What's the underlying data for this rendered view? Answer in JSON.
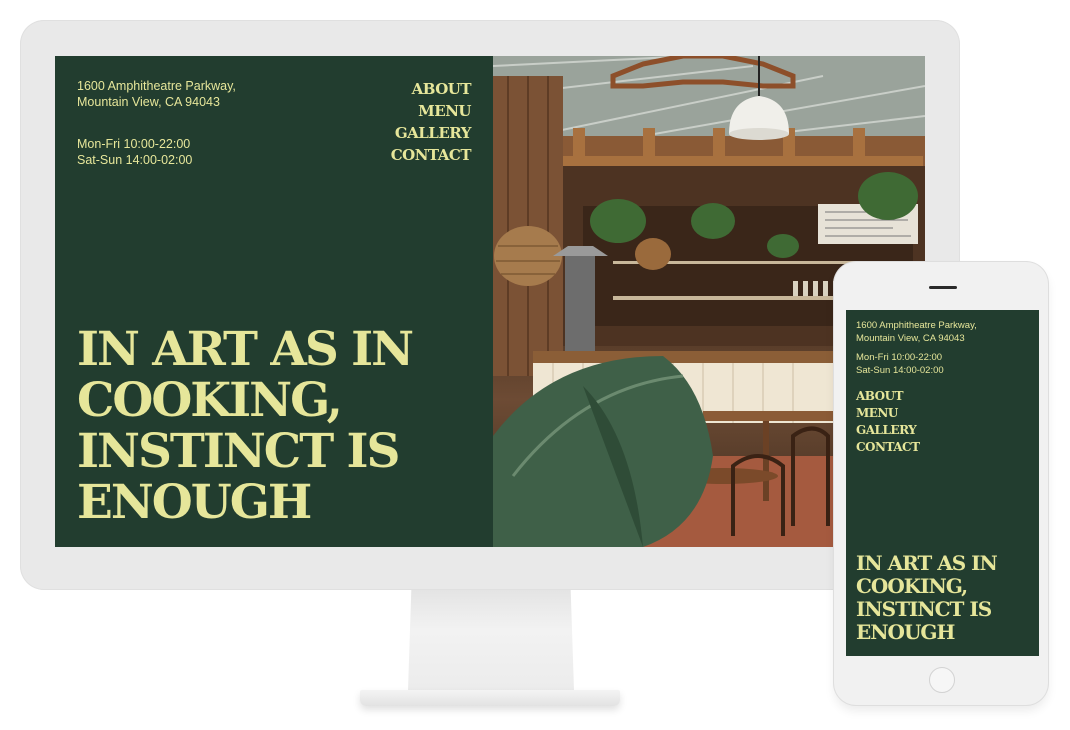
{
  "site": {
    "address": [
      "1600 Amphitheatre Parkway,",
      "Mountain View, CA 94043"
    ],
    "hours": [
      "Mon-Fri 10:00-22:00",
      "Sat-Sun 14:00-02:00"
    ],
    "nav": [
      "ABOUT",
      "MENU",
      "GALLERY",
      "CONTACT"
    ],
    "headline": [
      "IN ART AS IN",
      "COOKING,",
      "INSTINCT IS",
      "ENOUGH"
    ]
  },
  "colors": {
    "background": "#223d2f",
    "accent": "#e6e69a"
  }
}
